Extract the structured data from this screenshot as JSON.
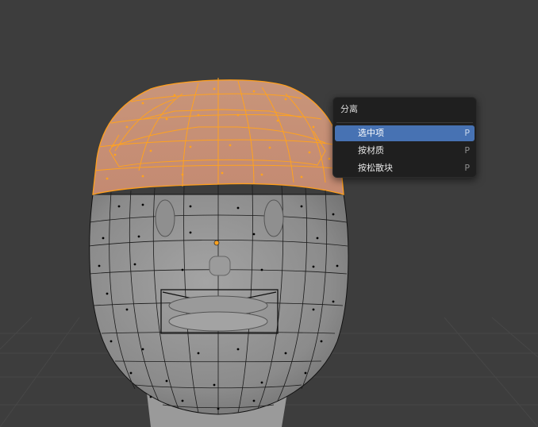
{
  "menu": {
    "title": "分离",
    "items": [
      {
        "label": "选中项",
        "shortcut": "P",
        "active": true
      },
      {
        "label": "按材质",
        "shortcut": "P",
        "active": false
      },
      {
        "label": "按松散块",
        "shortcut": "P",
        "active": false
      }
    ]
  },
  "colors": {
    "viewport_bg": "#3d3d3d",
    "mesh_gray": "#8a8a8a",
    "selection_orange": "#ffa21f",
    "menu_bg": "#1f1f1f",
    "menu_highlight": "#4772b3"
  }
}
